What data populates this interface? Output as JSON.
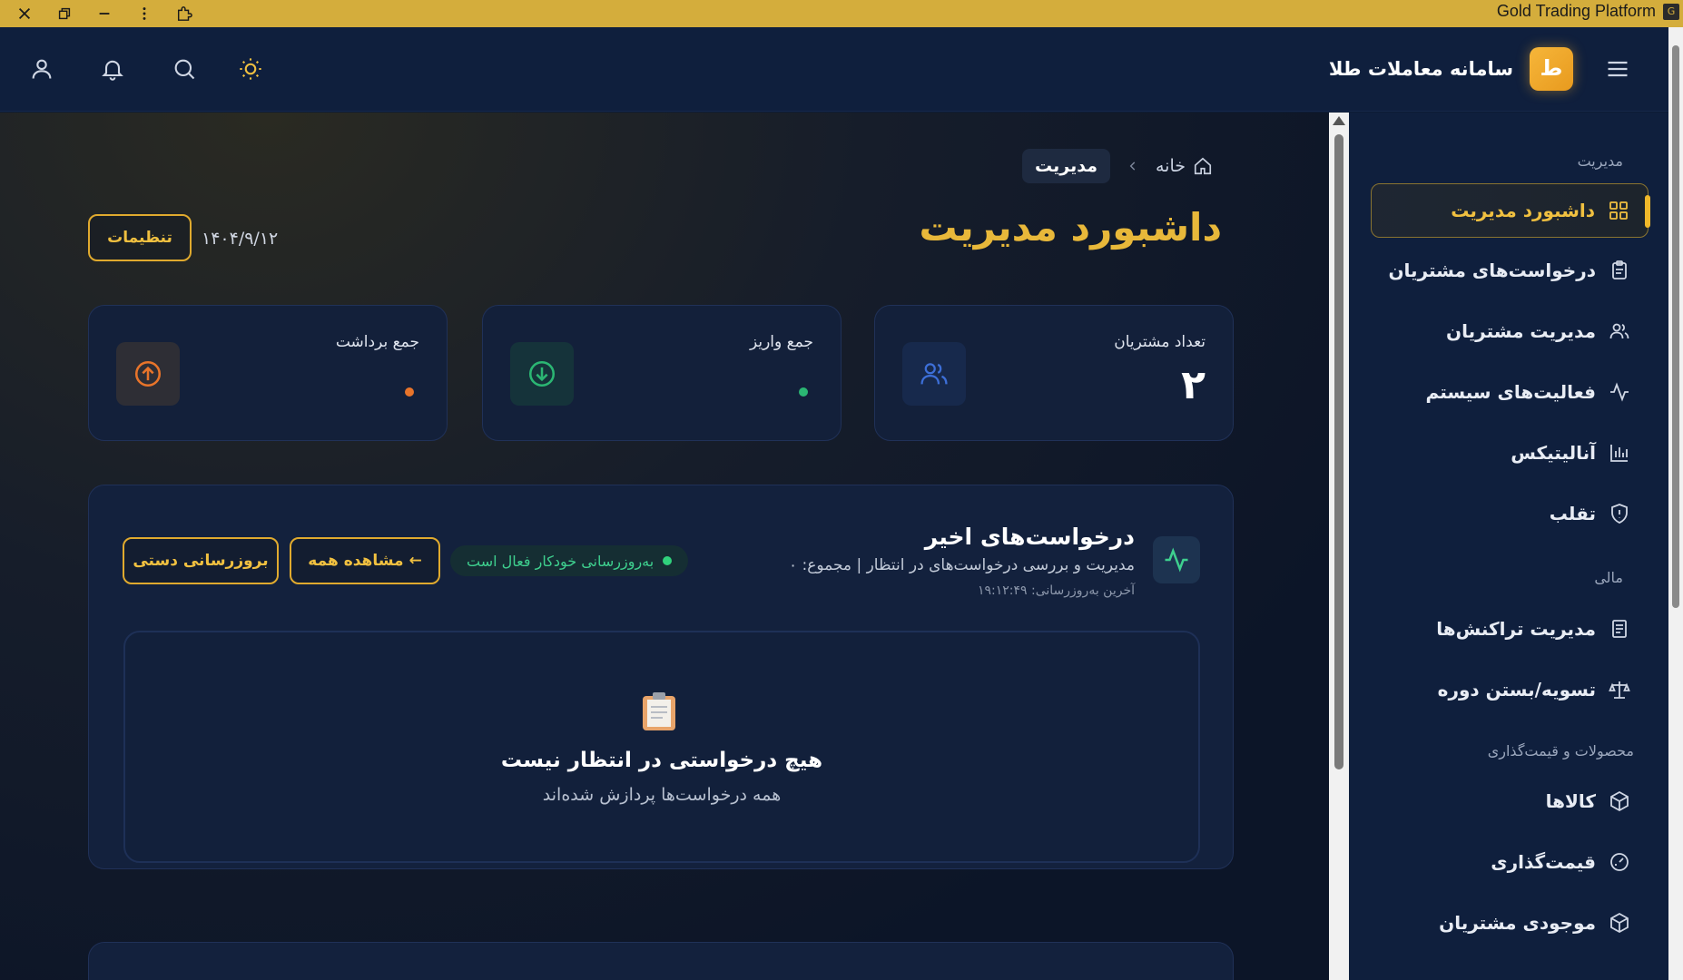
{
  "window": {
    "title": "Gold Trading Platform",
    "app_icon_letter": "G",
    "titlebar_color": "#d4ad3c"
  },
  "header": {
    "brand_logo_letter": "ط",
    "brand_name": "سامانه معاملات طلا",
    "icons": [
      "user-icon",
      "bell-icon",
      "search-icon",
      "sun-icon",
      "hamburger-icon"
    ]
  },
  "breadcrumb": {
    "home": "خانه",
    "current": "مدیریت"
  },
  "page": {
    "title": "داشبورد مدیریت",
    "date": "۱۴۰۴/۹/۱۲",
    "settings_button": "تنظیمات"
  },
  "stats": [
    {
      "label": "تعداد مشتریان",
      "value": "۲",
      "icon": "users-icon"
    },
    {
      "label": "جمع واریز",
      "value": "",
      "icon": "arrow-down-circle-icon",
      "dot_color": "#2bb673"
    },
    {
      "label": "جمع برداشت",
      "value": "",
      "icon": "arrow-up-circle-icon",
      "dot_color": "#e8742a"
    }
  ],
  "recent": {
    "title": "درخواست‌های اخیر",
    "subtitle": "مدیریت و بررسی درخواست‌های در انتظار | مجموع: ۰",
    "last_update": "آخرین به‌روزرسانی: ۱۹:۱۲:۴۹",
    "auto_update_badge": "به‌روزرسانی خودکار فعال است",
    "view_all_button": "مشاهده همه ←",
    "manual_refresh_button": "بروزرسانی دستی",
    "empty_title": "هیچ درخواستی در انتظار نیست",
    "empty_subtitle": "همه درخواست‌ها پردازش شده‌اند"
  },
  "sidebar": {
    "sections": [
      {
        "title": "مدیریت",
        "items": [
          {
            "label": "داشبورد مدیریت",
            "icon": "grid-icon",
            "active": true
          },
          {
            "label": "درخواست‌های مشتریان",
            "icon": "clipboard-icon"
          },
          {
            "label": "مدیریت مشتریان",
            "icon": "users-icon"
          },
          {
            "label": "فعالیت‌های سیستم",
            "icon": "activity-icon"
          },
          {
            "label": "آنالیتیکس",
            "icon": "bar-chart-icon"
          },
          {
            "label": "تقلب",
            "icon": "shield-icon"
          }
        ]
      },
      {
        "title": "مالی",
        "items": [
          {
            "label": "مدیریت تراکنش‌ها",
            "icon": "receipt-icon"
          },
          {
            "label": "تسویه/بستن دوره",
            "icon": "scale-icon"
          }
        ]
      },
      {
        "title": "محصولات و قیمت‌گذاری",
        "items": [
          {
            "label": "کالاها",
            "icon": "package-icon"
          },
          {
            "label": "قیمت‌گذاری",
            "icon": "gauge-icon"
          },
          {
            "label": "موجودی مشتریان",
            "icon": "box-icon"
          }
        ]
      }
    ]
  },
  "colors": {
    "accent": "#e8b83a",
    "background": "#0d1b34",
    "card": "#13203a",
    "success": "#30d17c"
  }
}
